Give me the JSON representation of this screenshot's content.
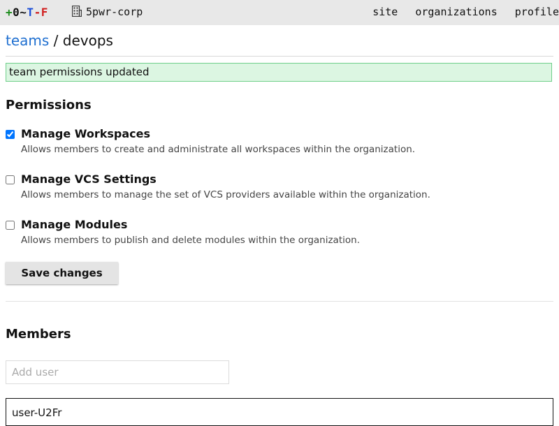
{
  "topbar": {
    "logo": {
      "plus": "+",
      "zero": "0",
      "tilde": "~",
      "t": "T",
      "minus": "-",
      "f": "F"
    },
    "org_icon": "building-icon",
    "org_name": "5pwr-corp",
    "nav": {
      "site": "site",
      "organizations": "organizations",
      "profile": "profile"
    }
  },
  "breadcrumb": {
    "parent": "teams",
    "separator": "/",
    "current": "devops"
  },
  "flash": {
    "message": "team permissions updated"
  },
  "permissions": {
    "heading": "Permissions",
    "items": [
      {
        "title": "Manage Workspaces",
        "description": "Allows members to create and administrate all workspaces within the organization.",
        "checked": true
      },
      {
        "title": "Manage VCS Settings",
        "description": "Allows members to manage the set of VCS providers available within the organization.",
        "checked": false
      },
      {
        "title": "Manage Modules",
        "description": "Allows members to publish and delete modules within the organization.",
        "checked": false
      }
    ],
    "save_label": "Save changes"
  },
  "members": {
    "heading": "Members",
    "add_user_placeholder": "Add user",
    "list": [
      {
        "username": "user-U2Fr"
      }
    ]
  },
  "colors": {
    "topbar_bg": "#e8e8e8",
    "link": "#1f6fd0",
    "flash_bg": "#dcf6e2",
    "flash_border": "#6fcf8a"
  }
}
